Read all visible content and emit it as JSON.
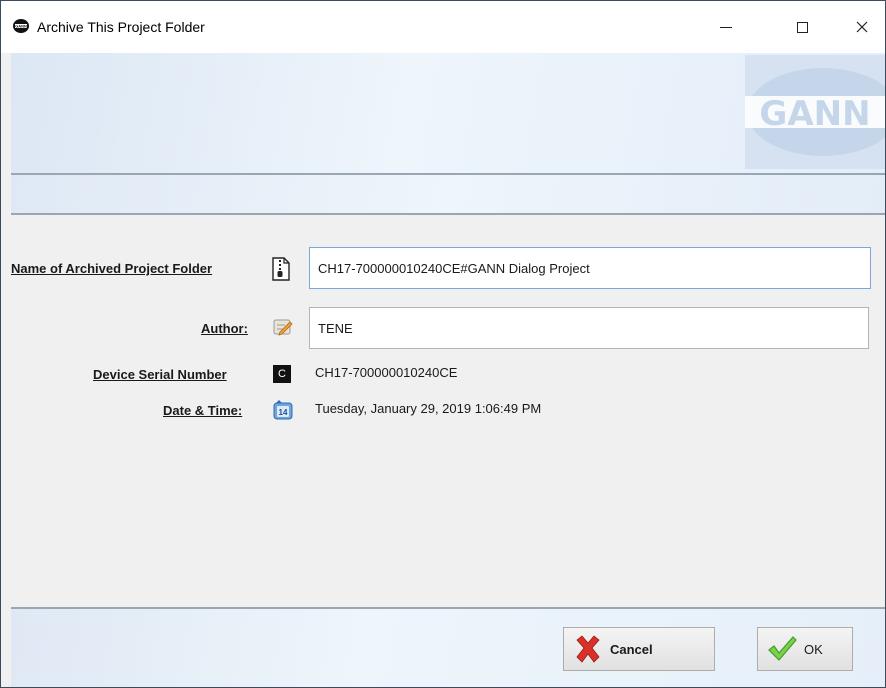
{
  "window": {
    "title": "Archive This Project Folder",
    "app_icon": "gann-app-icon",
    "controls": [
      "minimize",
      "maximize",
      "close"
    ]
  },
  "banner": {
    "logo_text": "GANN"
  },
  "form": {
    "folder_name": {
      "label": "Name of Archived Project Folder",
      "icon": "zip-archive-icon",
      "value": "CH17-700000010240CE#GANN Dialog Project"
    },
    "author": {
      "label": "Author:",
      "icon": "pencil-note-icon",
      "value": "TENE"
    },
    "serial": {
      "label": "Device Serial Number",
      "icon": "device-serial-icon",
      "icon_glyph": "C",
      "value": "CH17-700000010240CE"
    },
    "datetime": {
      "label": "Date & Time:",
      "icon": "calendar-icon",
      "icon_glyph": "14",
      "value": "Tuesday, January 29, 2019 1:06:49 PM"
    }
  },
  "footer": {
    "cancel_label": "Cancel",
    "ok_label": "OK"
  },
  "colors": {
    "banner_bg": "#e4eef9",
    "logo_bg": "#d6e2f2",
    "separator": "#9aa6b2",
    "cancel_x": "#d9302a",
    "ok_check": "#3aa12c"
  }
}
